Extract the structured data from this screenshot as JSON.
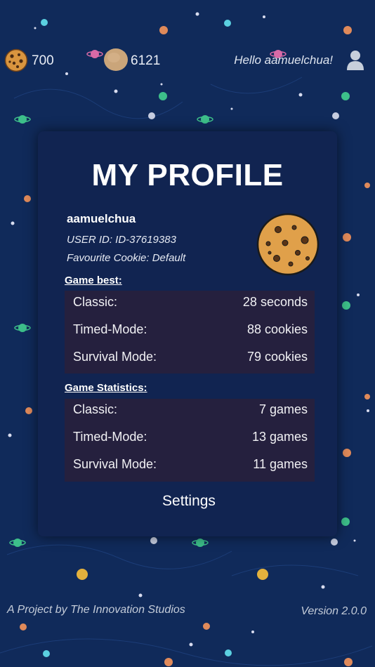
{
  "topbar": {
    "cookie_count": "700",
    "coin_count": "6121",
    "greeting": "Hello aamuelchua!"
  },
  "profile": {
    "title": "MY PROFILE",
    "username": "aamuelchua",
    "user_id": "USER ID: ID-37619383",
    "favourite_cookie": "Favourite Cookie: Default"
  },
  "game_best": {
    "heading": "Game best:",
    "rows": [
      {
        "label": "Classic:",
        "value": "28 seconds"
      },
      {
        "label": "Timed-Mode:",
        "value": "88 cookies"
      },
      {
        "label": "Survival Mode:",
        "value": "79 cookies"
      }
    ]
  },
  "game_stats": {
    "heading": "Game Statistics:",
    "rows": [
      {
        "label": "Classic:",
        "value": "7 games"
      },
      {
        "label": "Timed-Mode:",
        "value": "13 games"
      },
      {
        "label": "Survival Mode:",
        "value": "11 games"
      }
    ]
  },
  "settings_label": "Settings",
  "footer": {
    "credit": "A Project by The Innovation Studios",
    "version": "Version 2.0.0"
  },
  "colors": {
    "background": "#102a5a",
    "card": "#112451",
    "stat_box": "#25203e",
    "cookie": "#e0a04a"
  },
  "icons": [
    "cookie-icon",
    "coin-icon",
    "user-icon",
    "planet-decoration",
    "star-decoration"
  ]
}
